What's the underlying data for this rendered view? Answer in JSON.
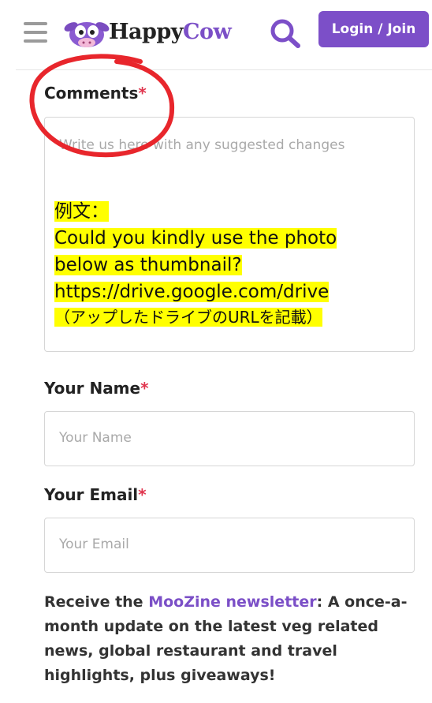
{
  "header": {
    "logo_happy": "Happy",
    "logo_cow": "Cow",
    "login_label": "Login / Join"
  },
  "comments": {
    "label": "Comments",
    "required_mark": "*",
    "placeholder": "Write us here with any suggested changes",
    "example_lines": [
      "例文：",
      "Could you kindly use the photo",
      "below as thumbnail?",
      "https://drive.google.com/drive",
      "（アップしたドライブのURLを記載）"
    ]
  },
  "name": {
    "label": "Your Name",
    "required_mark": "*",
    "placeholder": "Your Name"
  },
  "email": {
    "label": "Your Email",
    "required_mark": "*",
    "placeholder": "Your Email"
  },
  "newsletter": {
    "prefix": "Receive the ",
    "link": "MooZine newsletter",
    "suffix": ": A once-a-month update on the latest veg related news, global restaurant and travel highlights, plus giveaways!"
  },
  "colors": {
    "brand_purple": "#7c4fc8",
    "required_red": "#e0354e",
    "highlight_yellow": "#ffff00",
    "annotation_red": "#e8262c"
  }
}
